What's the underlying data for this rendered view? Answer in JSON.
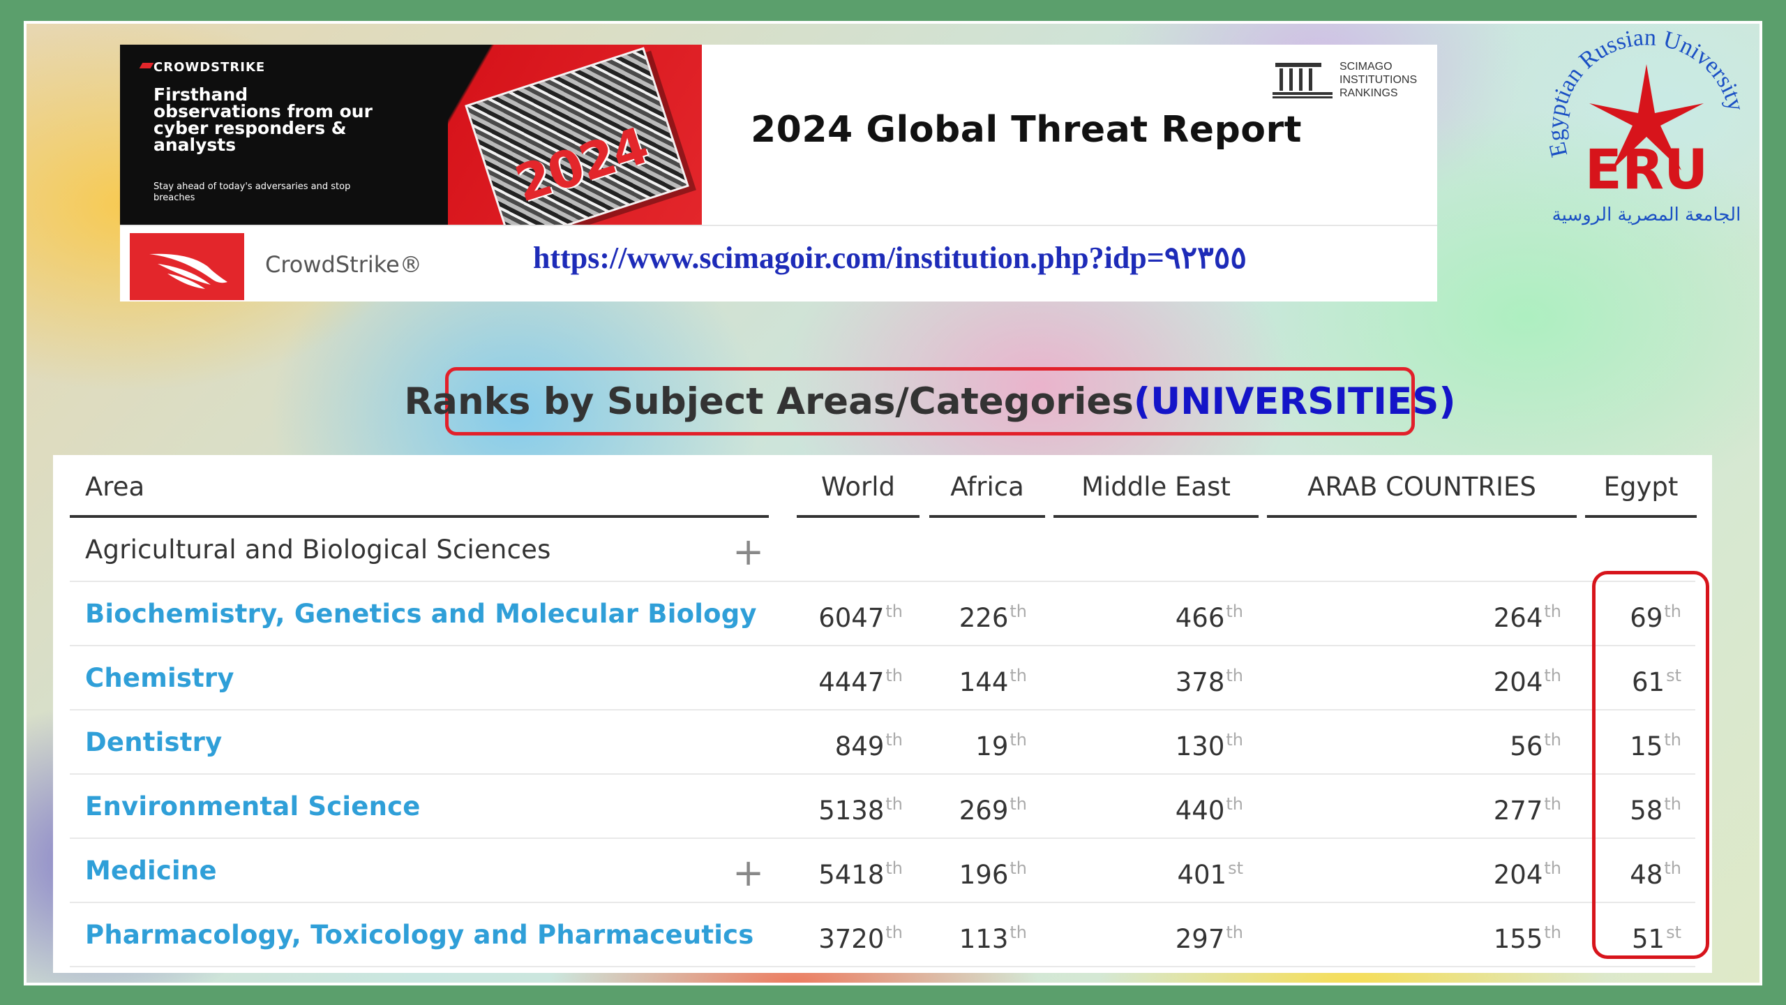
{
  "banner": {
    "ad_brand": "CROWDSTRIKE",
    "ad_headline": "Firsthand observations from our cyber responders & analysts",
    "ad_small": "Stay ahead of today's adversaries and stop breaches",
    "book_year": "2024",
    "scimago_text": "SCIMAGO INSTITUTIONS RANKINGS",
    "report_title": "2024 Global Threat Report",
    "company_name": "CrowdStrike®",
    "url": "https://www.scimagoir.com/institution.php?idp=٩٢٣٥٥"
  },
  "eru_logo": {
    "arc_text": "Egyptian Russian University",
    "letters": "ERU",
    "arabic_text": "الجامعة المصرية الروسية",
    "colors": {
      "blue": "#1a4fc4",
      "red": "#d7141b"
    }
  },
  "section_title": {
    "main": "Ranks by Subject Areas/Categories ",
    "accent": "(UNIVERSITIES)"
  },
  "table": {
    "headers": {
      "area": "Area",
      "world": "World",
      "africa": "Africa",
      "middle_east": "Middle East",
      "arab": "ARAB COUNTRIES",
      "egypt": "Egypt"
    },
    "category": "Agricultural and Biological Sciences",
    "rows": [
      {
        "area": "Biochemistry, Genetics and Molecular Biology",
        "world": "6047",
        "world_s": "th",
        "africa": "226",
        "africa_s": "th",
        "me": "466",
        "me_s": "th",
        "arab": "264",
        "arab_s": "th",
        "egypt": "69",
        "egypt_s": "th"
      },
      {
        "area": "Chemistry",
        "world": "4447",
        "world_s": "th",
        "africa": "144",
        "africa_s": "th",
        "me": "378",
        "me_s": "th",
        "arab": "204",
        "arab_s": "th",
        "egypt": "61",
        "egypt_s": "st"
      },
      {
        "area": "Dentistry",
        "world": "849",
        "world_s": "th",
        "africa": "19",
        "africa_s": "th",
        "me": "130",
        "me_s": "th",
        "arab": "56",
        "arab_s": "th",
        "egypt": "15",
        "egypt_s": "th"
      },
      {
        "area": "Environmental Science",
        "world": "5138",
        "world_s": "th",
        "africa": "269",
        "africa_s": "th",
        "me": "440",
        "me_s": "th",
        "arab": "277",
        "arab_s": "th",
        "egypt": "58",
        "egypt_s": "th"
      },
      {
        "area": "Medicine",
        "world": "5418",
        "world_s": "th",
        "africa": "196",
        "africa_s": "th",
        "me": "401",
        "me_s": "st",
        "arab": "204",
        "arab_s": "th",
        "egypt": "48",
        "egypt_s": "th"
      },
      {
        "area": "Pharmacology, Toxicology and Pharmaceutics",
        "world": "3720",
        "world_s": "th",
        "africa": "113",
        "africa_s": "th",
        "me": "297",
        "me_s": "th",
        "arab": "155",
        "arab_s": "th",
        "egypt": "51",
        "egypt_s": "st"
      }
    ]
  }
}
